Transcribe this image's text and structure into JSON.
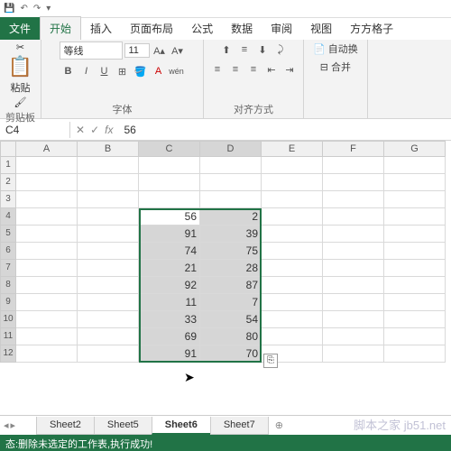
{
  "qat_icons": [
    "save",
    "undo",
    "redo",
    "dropdown"
  ],
  "tabs": {
    "file": "文件",
    "active": "开始",
    "others": [
      "插入",
      "页面布局",
      "公式",
      "数据",
      "审阅",
      "视图",
      "方方格子"
    ]
  },
  "ribbon": {
    "clipboard": {
      "label": "剪贴板",
      "paste": "粘贴"
    },
    "font": {
      "label": "字体",
      "name": "等线",
      "size": "11",
      "bold": "B",
      "italic": "I",
      "underline": "U"
    },
    "align": {
      "label": "对齐方式"
    },
    "extra": {
      "wrap": "自动换",
      "merge": "合并"
    }
  },
  "namebox": {
    "ref": "C4",
    "fx": "fx",
    "value": "56"
  },
  "cols": [
    "A",
    "B",
    "C",
    "D",
    "E",
    "F",
    "G"
  ],
  "rows": [
    "1",
    "2",
    "3",
    "4",
    "5",
    "6",
    "7",
    "8",
    "9",
    "10",
    "11",
    "12"
  ],
  "chart_data": {
    "type": "table",
    "selected_range": "C4:D12",
    "active_cell": "C4",
    "columns": [
      "C",
      "D"
    ],
    "data": [
      [
        56,
        2
      ],
      [
        91,
        39
      ],
      [
        74,
        75
      ],
      [
        21,
        28
      ],
      [
        92,
        87
      ],
      [
        11,
        7
      ],
      [
        33,
        54
      ],
      [
        69,
        80
      ],
      [
        91,
        70
      ]
    ]
  },
  "sheets": {
    "items": [
      "Sheet2",
      "Sheet5",
      "Sheet6",
      "Sheet7"
    ],
    "active": "Sheet6"
  },
  "status": "态:删除未选定的工作表,执行成功!",
  "watermark": "脚本之家 jb51.net"
}
